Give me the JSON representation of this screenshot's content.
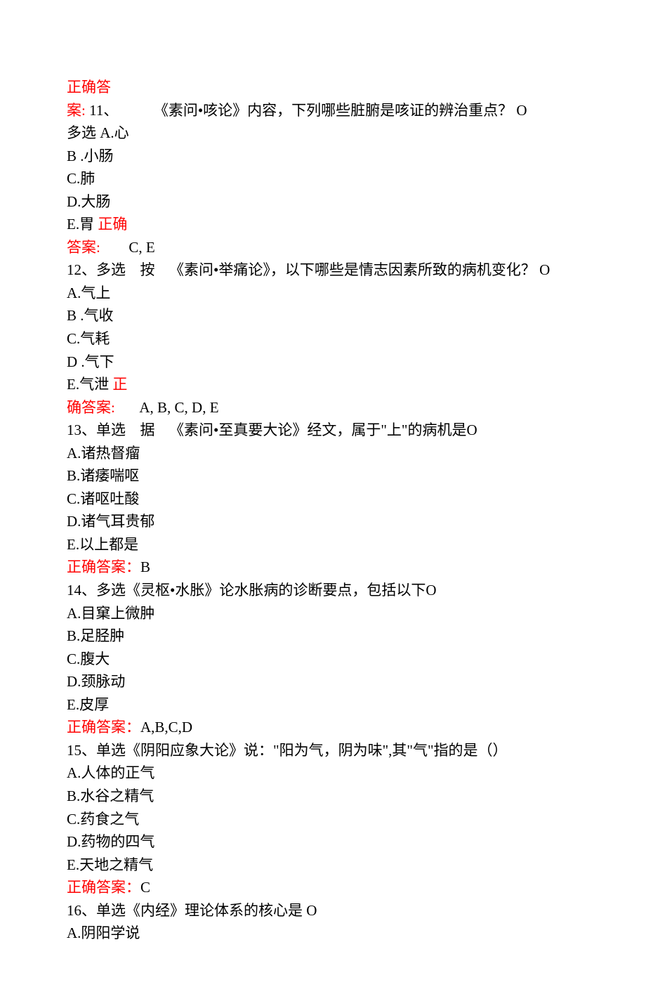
{
  "questions": [
    {
      "answer_prefix_1": "正确答",
      "answer_prefix_2": "案: ",
      "number": "11、",
      "stem_main": "《素问•咳论》内容，下列哪些脏腑是咳证的辨治重点？ O",
      "type_line": "多选 A.心",
      "options": [
        "B .小肠",
        "C.肺",
        "D.大肠"
      ],
      "last_option": "E.胃 ",
      "ans_frag_1": "正确",
      "ans_frag_2": "答案:",
      "answer_value": "C, E"
    },
    {
      "number": "12、多选",
      "stem_prefix": "按",
      "stem_main": "《素问•举痛论》，以下哪些是情志因素所致的病机变化？ O",
      "options": [
        "A.气上",
        "B .气收",
        "C.气耗",
        "D .气下"
      ],
      "last_option": "E.气泄 ",
      "ans_frag_1": "正",
      "ans_frag_2": "确答案:",
      "answer_value": "A, B, C, D, E"
    },
    {
      "number": "13、单选",
      "stem_prefix": "据",
      "stem_main": "《素问•至真要大论》经文，属于\"上\"的病机是O",
      "options": [
        "A.诸热督瘤",
        "B.诸痿喘呕",
        "C.诸呕吐酸",
        "D.诸气耳贵郁",
        "E.以上都是"
      ],
      "answer_label": "正确答案：",
      "answer_value": "B"
    },
    {
      "number": "14、多选",
      "stem_main": "《灵枢•水胀》论水胀病的诊断要点，包括以下O",
      "options": [
        "A.目窠上微肿",
        "B.足胫肿",
        "C.腹大",
        "D.颈脉动",
        "E.皮厚"
      ],
      "answer_label": "正确答案：",
      "answer_value": "A,B,C,D"
    },
    {
      "number": "15、单选",
      "stem_main": "《阴阳应象大论》说：\"阳为气，阴为味\",其\"气\"指的是（）",
      "options": [
        "A.人体的正气",
        "B.水谷之精气",
        "C.药食之气",
        "D.药物的四气",
        "E.天地之精气"
      ],
      "answer_label": "正确答案：",
      "answer_value": "C"
    },
    {
      "number": "16、单选",
      "stem_main": "《内经》理论体系的核心是 O",
      "options": [
        "A.阴阳学说"
      ]
    }
  ]
}
